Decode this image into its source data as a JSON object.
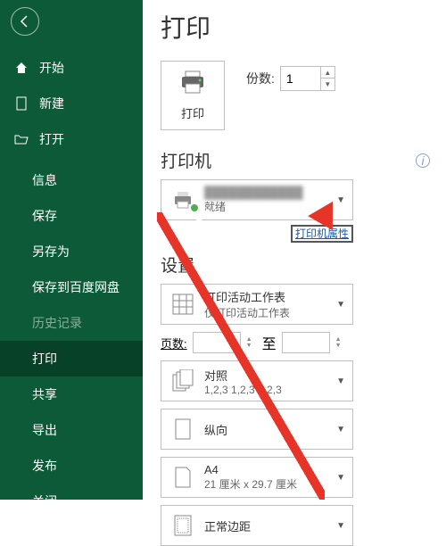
{
  "page_title": "打印",
  "sidebar": {
    "items": [
      {
        "label": "开始",
        "icon": "home"
      },
      {
        "label": "新建",
        "icon": "document"
      },
      {
        "label": "打开",
        "icon": "folder"
      }
    ],
    "sub_items": [
      {
        "label": "信息"
      },
      {
        "label": "保存"
      },
      {
        "label": "另存为"
      },
      {
        "label": "保存到百度网盘"
      },
      {
        "label": "历史记录",
        "disabled": true
      },
      {
        "label": "打印",
        "active": true
      },
      {
        "label": "共享"
      },
      {
        "label": "导出"
      },
      {
        "label": "发布"
      },
      {
        "label": "关闭"
      }
    ]
  },
  "print_button_label": "打印",
  "copies_label": "份数:",
  "copies_value": "1",
  "printer_section_title": "打印机",
  "printer_status": "就绪",
  "printer_props_link": "打印机属性",
  "settings_section_title": "设置",
  "active_sheets": {
    "line1": "打印活动工作表",
    "line2": "仅打印活动工作表"
  },
  "pages_label": "页数:",
  "pages_to": "至",
  "collate": {
    "line1": "对照",
    "line2": "1,2,3   1,2,3   1,2,3"
  },
  "orientation": {
    "line1": "纵向"
  },
  "paper": {
    "line1": "A4",
    "line2": "21 厘米 x 29.7 厘米"
  },
  "margins": {
    "line1": "正常边距"
  }
}
